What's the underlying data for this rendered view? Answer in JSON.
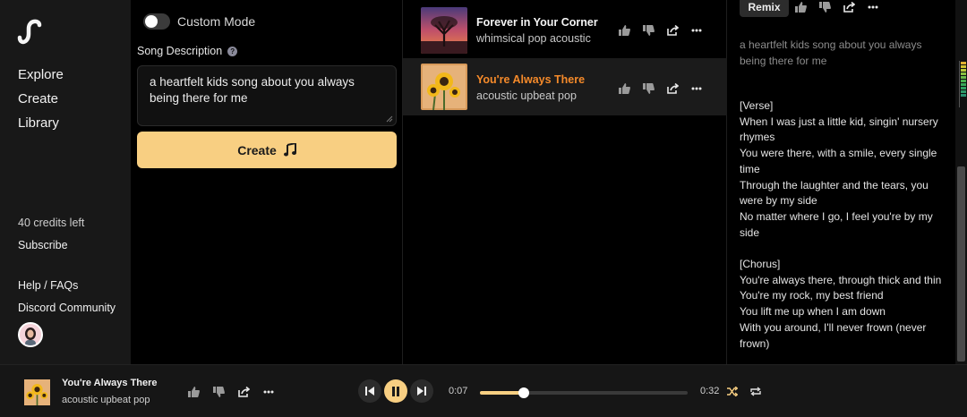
{
  "sidebar": {
    "nav": [
      "Explore",
      "Create",
      "Library"
    ],
    "credits": "40 credits left",
    "subscribe": "Subscribe",
    "help": "Help / FAQs",
    "discord": "Discord Community"
  },
  "create": {
    "mode_label": "Custom Mode",
    "description_label": "Song Description",
    "description_value": "a heartfelt kids song about you always being there for me",
    "create_label": "Create"
  },
  "songs": [
    {
      "title": "Forever in Your Corner",
      "style": "whimsical pop acoustic"
    },
    {
      "title": "You're Always There",
      "style": "acoustic upbeat pop"
    }
  ],
  "lyrics_panel": {
    "remix_label": "Remix",
    "description": "a heartfelt kids song about you always being there for me",
    "lyrics": "[Verse]\nWhen I was just a little kid, singin' nursery rhymes\nYou were there, with a smile, every single time\nThrough the laughter and the tears, you were by my side\nNo matter where I go, I feel you're by my side\n\n[Chorus]\nYou're always there, through thick and thin\nYou're my rock, my best friend\nYou lift me up when I am down\nWith you around, I'll never frown (never frown)"
  },
  "player": {
    "title": "You're Always There",
    "style": "acoustic upbeat pop",
    "current_time": "0:07",
    "total_time": "0:32",
    "progress": 0.21
  },
  "colors": {
    "accent": "#f8cf82",
    "active_title": "#f58a2a",
    "shuffle": "#f8cf82"
  }
}
